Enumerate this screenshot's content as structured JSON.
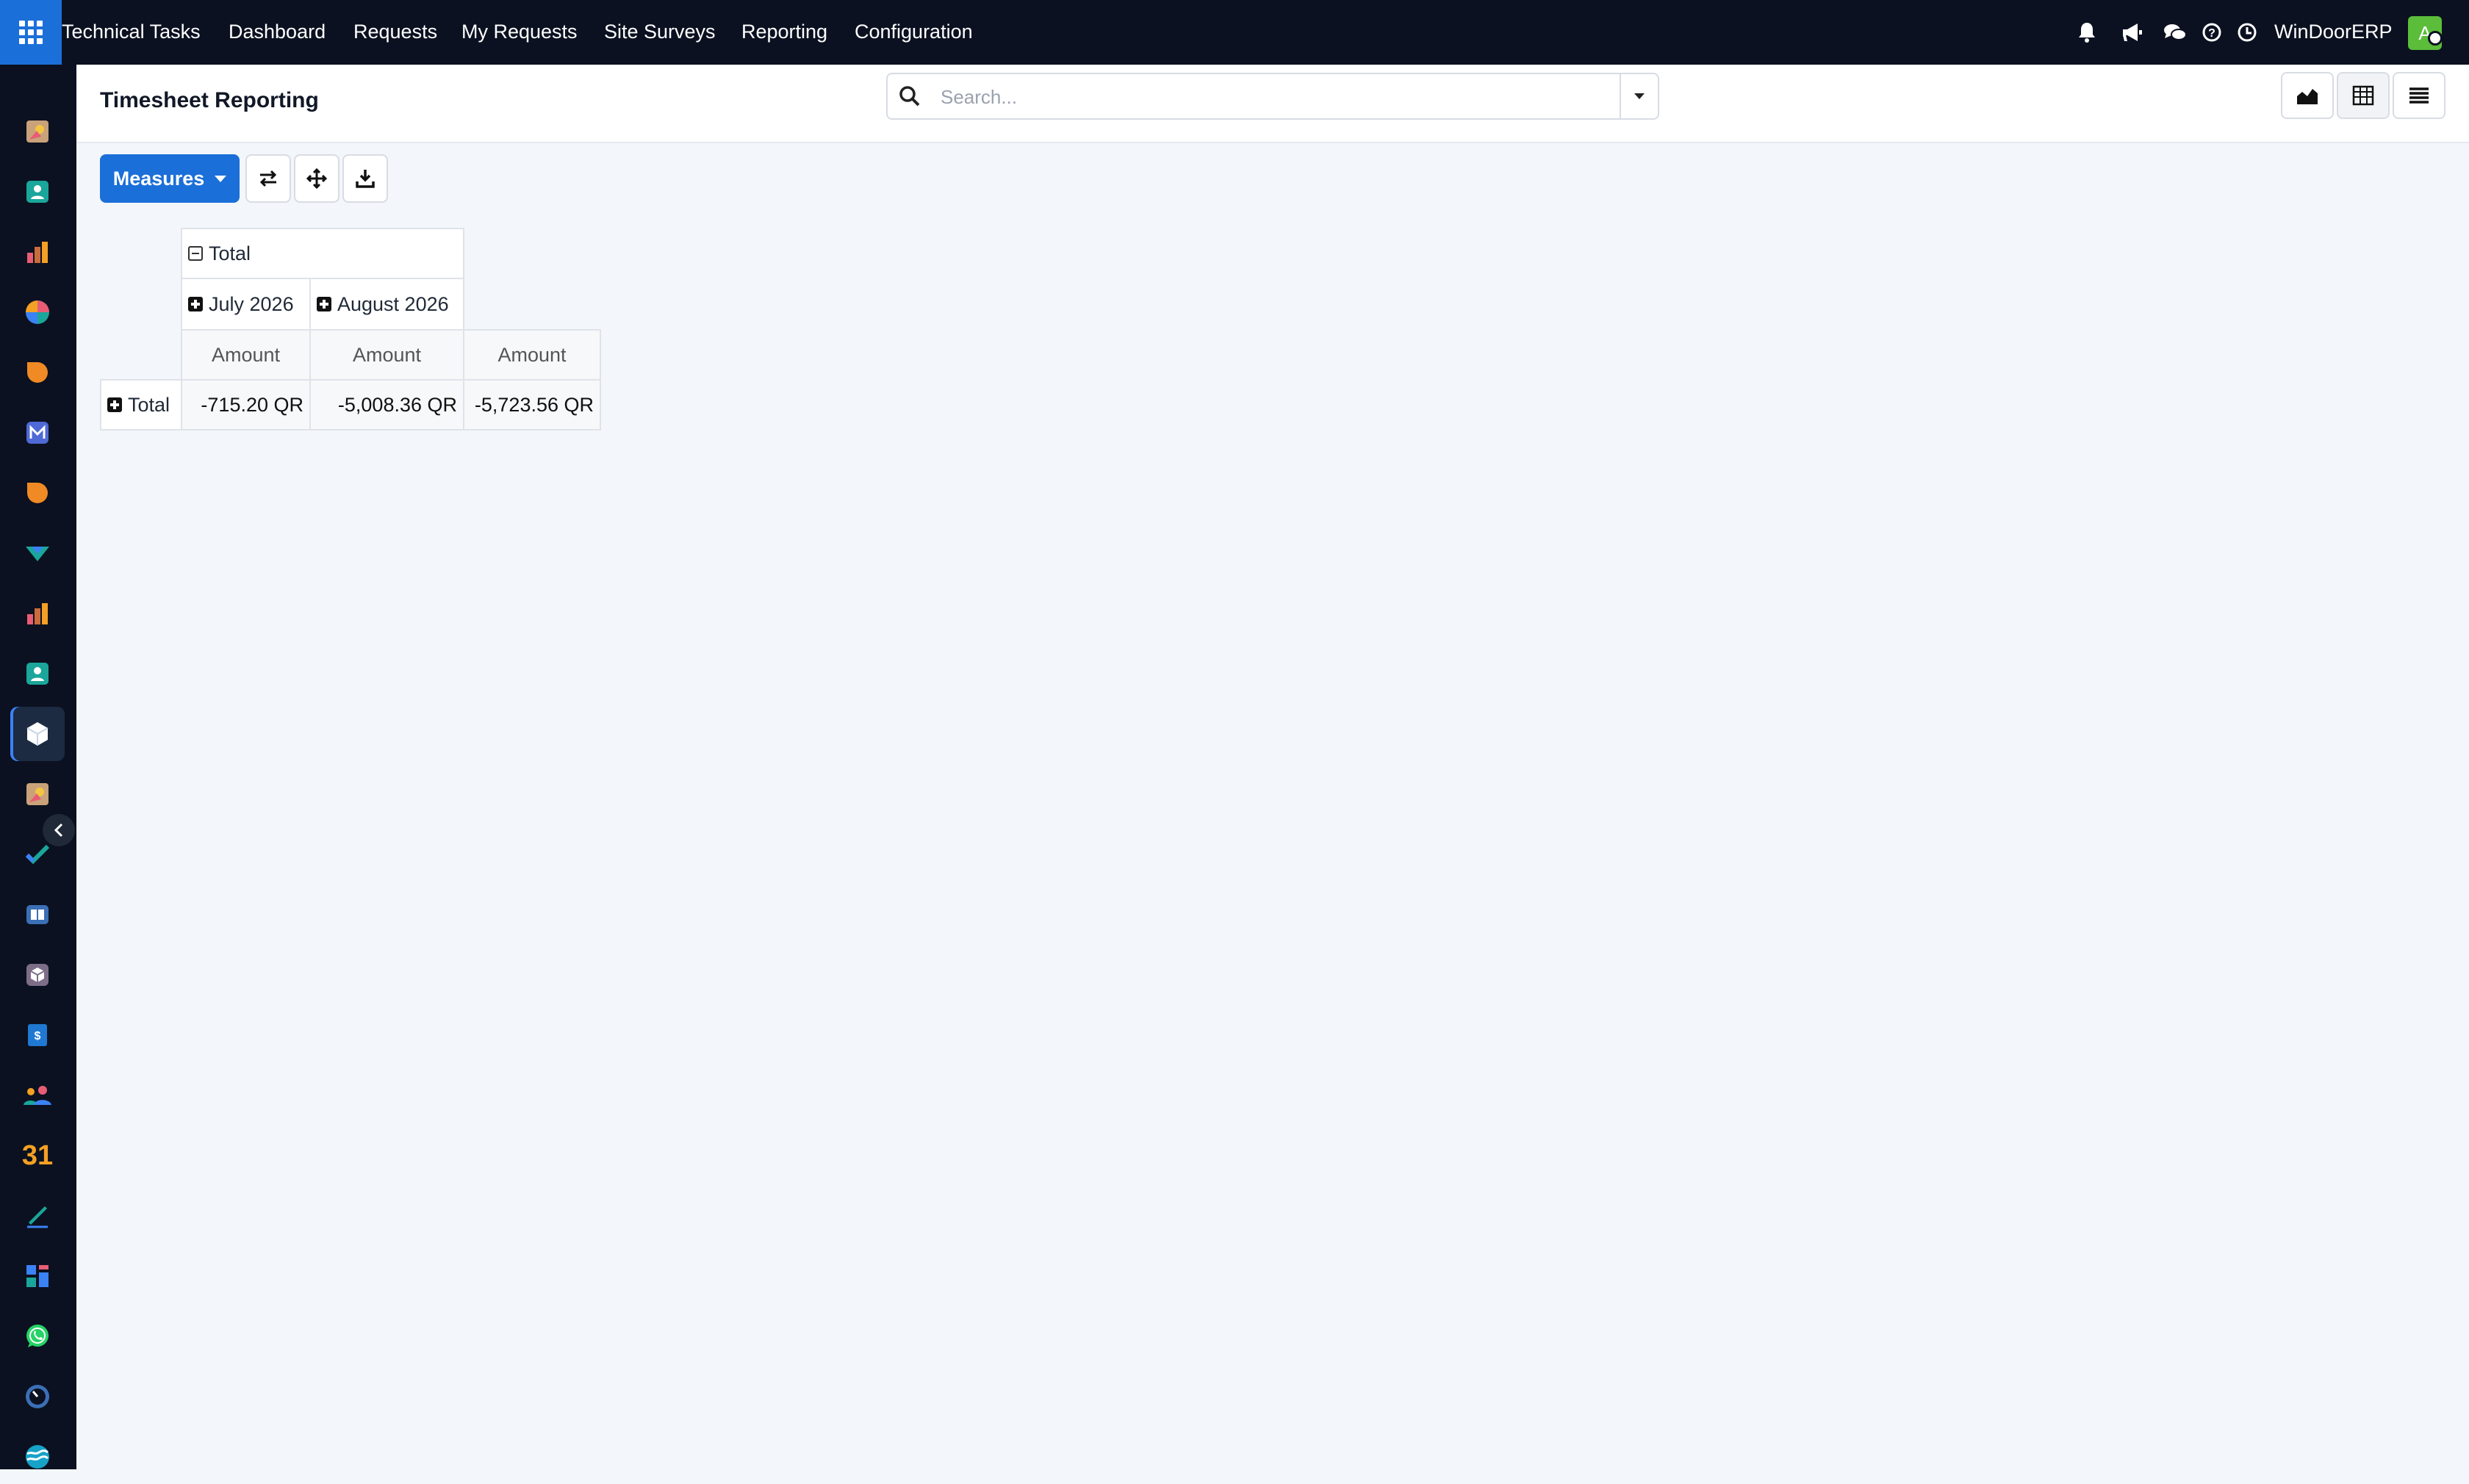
{
  "navbar": {
    "app_name": "Technical Tasks",
    "menu": [
      "Dashboard",
      "Requests",
      "My Requests",
      "Site Surveys",
      "Reporting",
      "Configuration"
    ],
    "company": "WinDoorERP",
    "avatar_letter": "A",
    "icons": [
      "bell-icon",
      "megaphone-icon",
      "chat-icon",
      "help-icon",
      "clock-icon"
    ]
  },
  "sidebar": {
    "apps": [
      "app-1",
      "app-2",
      "app-3",
      "app-4",
      "app-5",
      "app-6",
      "app-7",
      "app-8",
      "app-9",
      "app-10",
      "app-11-active",
      "app-12",
      "app-13",
      "app-14",
      "app-15",
      "app-16",
      "app-17",
      "calendar-app",
      "app-19",
      "app-20",
      "whatsapp-app",
      "app-22",
      "app-23"
    ],
    "calendar_label": "31"
  },
  "control_panel": {
    "title": "Timesheet Reporting",
    "search_placeholder": "Search..."
  },
  "toolbar": {
    "measures_label": "Measures"
  },
  "pivot": {
    "col_root": "Total",
    "col_groups": [
      "July 2026",
      "August 2026"
    ],
    "measure": "Amount",
    "row_header": "Total",
    "values": [
      "-715.20 QR",
      "-5,008.36 QR",
      "-5,723.56 QR"
    ]
  },
  "colors": {
    "navbar_bg": "#0b1120",
    "accent": "#1b6fd8",
    "background": "#f3f6fa"
  }
}
